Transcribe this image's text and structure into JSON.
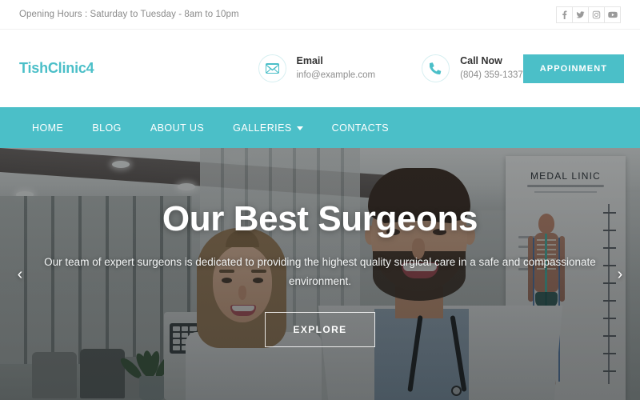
{
  "topbar": {
    "hours": "Opening Hours : Saturday to Tuesday - 8am to 10pm",
    "social": [
      {
        "name": "facebook-icon",
        "glyph": "f"
      },
      {
        "name": "twitter-icon",
        "glyph": "t"
      },
      {
        "name": "instagram-icon",
        "glyph": "i"
      },
      {
        "name": "youtube-icon",
        "glyph": "y"
      }
    ]
  },
  "header": {
    "logo": "TishClinic4",
    "contacts": [
      {
        "icon": "envelope-icon",
        "title": "Email",
        "value": "info@example.com"
      },
      {
        "icon": "phone-icon",
        "title": "Call Now",
        "value": "(804) 359-1337"
      }
    ],
    "appointment_label": "APPOINMENT"
  },
  "nav": {
    "items": [
      {
        "label": "HOME",
        "dropdown": false
      },
      {
        "label": "BLOG",
        "dropdown": false
      },
      {
        "label": "ABOUT US",
        "dropdown": false
      },
      {
        "label": "GALLERIES",
        "dropdown": true
      },
      {
        "label": "CONTACTS",
        "dropdown": false
      }
    ]
  },
  "hero": {
    "title": "Our Best Surgeons",
    "subtitle": "Our team of expert surgeons is dedicated to providing the highest quality surgical care in a safe and compassionate environment.",
    "cta_label": "EXPLORE",
    "prev_arrow": "‹",
    "next_arrow": "›",
    "poster_title": "MEDAL LINIC"
  },
  "colors": {
    "brand_teal": "#4BBFC8",
    "topbar_text": "#8a8a8a",
    "hero_text": "#ffffff"
  }
}
